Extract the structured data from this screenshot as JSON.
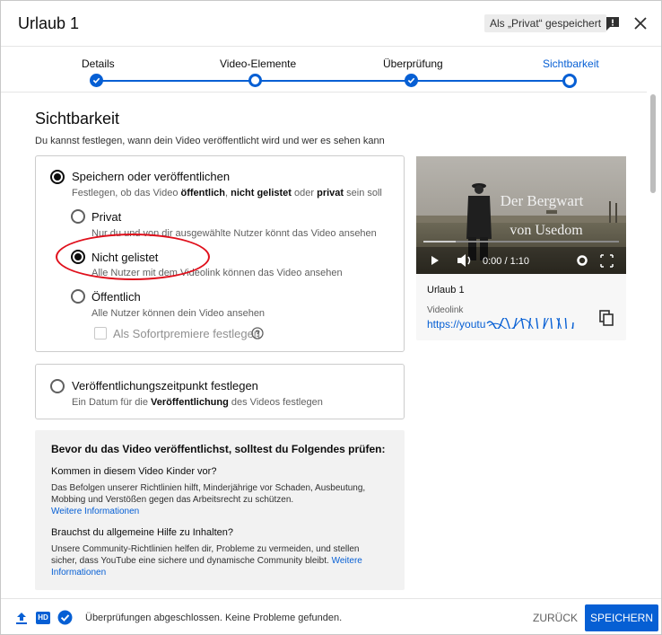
{
  "header": {
    "title": "Urlaub 1",
    "saved_badge": "Als „Privat“ gespeichert"
  },
  "stepper": {
    "steps": [
      {
        "label": "Details",
        "done": true
      },
      {
        "label": "Video-Elemente",
        "done": false
      },
      {
        "label": "Überprüfung",
        "done": true
      },
      {
        "label": "Sichtbarkeit",
        "done": false,
        "current": true
      }
    ]
  },
  "visibility": {
    "heading": "Sichtbarkeit",
    "subtitle": "Du kannst festlegen, wann dein Video veröffentlicht wird und wer es sehen kann",
    "save_publish": {
      "label": "Speichern oder veröffentlichen",
      "desc_parts": [
        "Festlegen, ob das Video ",
        "öffentlich",
        ", ",
        "nicht gelistet",
        " oder ",
        "privat",
        " sein soll"
      ]
    },
    "options": [
      {
        "label": "Privat",
        "desc": "Nur du und von dir ausgewählte Nutzer könnt das Video ansehen",
        "selected": false
      },
      {
        "label": "Nicht gelistet",
        "desc": "Alle Nutzer mit dem Videolink können das Video ansehen",
        "selected": true
      },
      {
        "label": "Öffentlich",
        "desc": "Alle Nutzer können dein Video ansehen",
        "selected": false
      }
    ],
    "premiere_label": "Als Sofortpremiere festlegen",
    "schedule": {
      "label": "Veröffentlichungszeitpunkt festlegen",
      "desc_parts": [
        "Ein Datum für die ",
        "Veröffentlichung",
        " des Videos festlegen"
      ]
    }
  },
  "video": {
    "overlay_line1": "Der Bergwart",
    "overlay_line2": "von Usedom",
    "time": "0:00 / 1:10",
    "title": "Urlaub 1",
    "link_label": "Videolink",
    "link": "https://youtu"
  },
  "checks": {
    "title": "Bevor du das Video veröffentlichst, solltest du Folgendes prüfen:",
    "q1": "Kommen in diesem Video Kinder vor?",
    "q1_text": "Das Befolgen unserer Richtlinien hilft, Minderjährige vor Schaden, Ausbeutung, Mobbing und Verstößen gegen das Arbeitsrecht zu schützen.",
    "q1_link": "Weitere Informationen",
    "q2": "Brauchst du allgemeine Hilfe zu Inhalten?",
    "q2_text": "Unsere Community-Richtlinien helfen dir, Probleme zu vermeiden, und stellen sicher, dass YouTube eine sichere und dynamische Community bleibt.",
    "q2_link": "Weitere Informationen"
  },
  "footer": {
    "status": "Überprüfungen abgeschlossen. Keine Probleme gefunden.",
    "back_label": "ZURÜCK",
    "save_label": "SPEICHERN",
    "hd_badge": "HD"
  },
  "colors": {
    "accent": "#065fd4",
    "annotation": "#e0101c"
  }
}
